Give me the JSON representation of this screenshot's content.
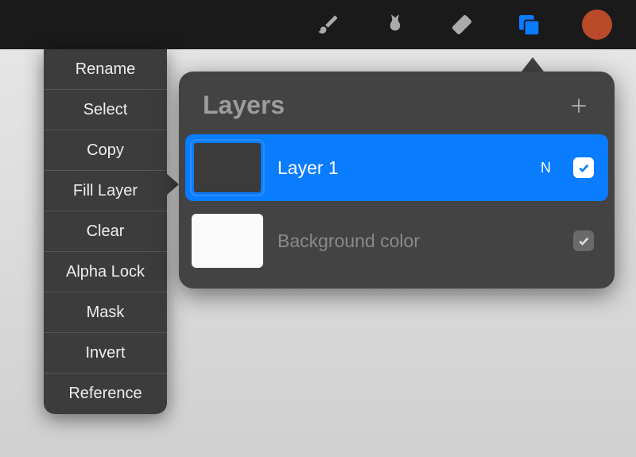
{
  "toolbar": {
    "icons": [
      "brush",
      "smudge",
      "eraser",
      "layers",
      "color"
    ]
  },
  "context_menu": {
    "items": [
      "Rename",
      "Select",
      "Copy",
      "Fill Layer",
      "Clear",
      "Alpha Lock",
      "Mask",
      "Invert",
      "Reference"
    ]
  },
  "layers_panel": {
    "title": "Layers",
    "layers": [
      {
        "name": "Layer 1",
        "blend": "N",
        "visible": true,
        "selected": true
      },
      {
        "name": "Background color",
        "visible": true,
        "selected": false
      }
    ]
  }
}
